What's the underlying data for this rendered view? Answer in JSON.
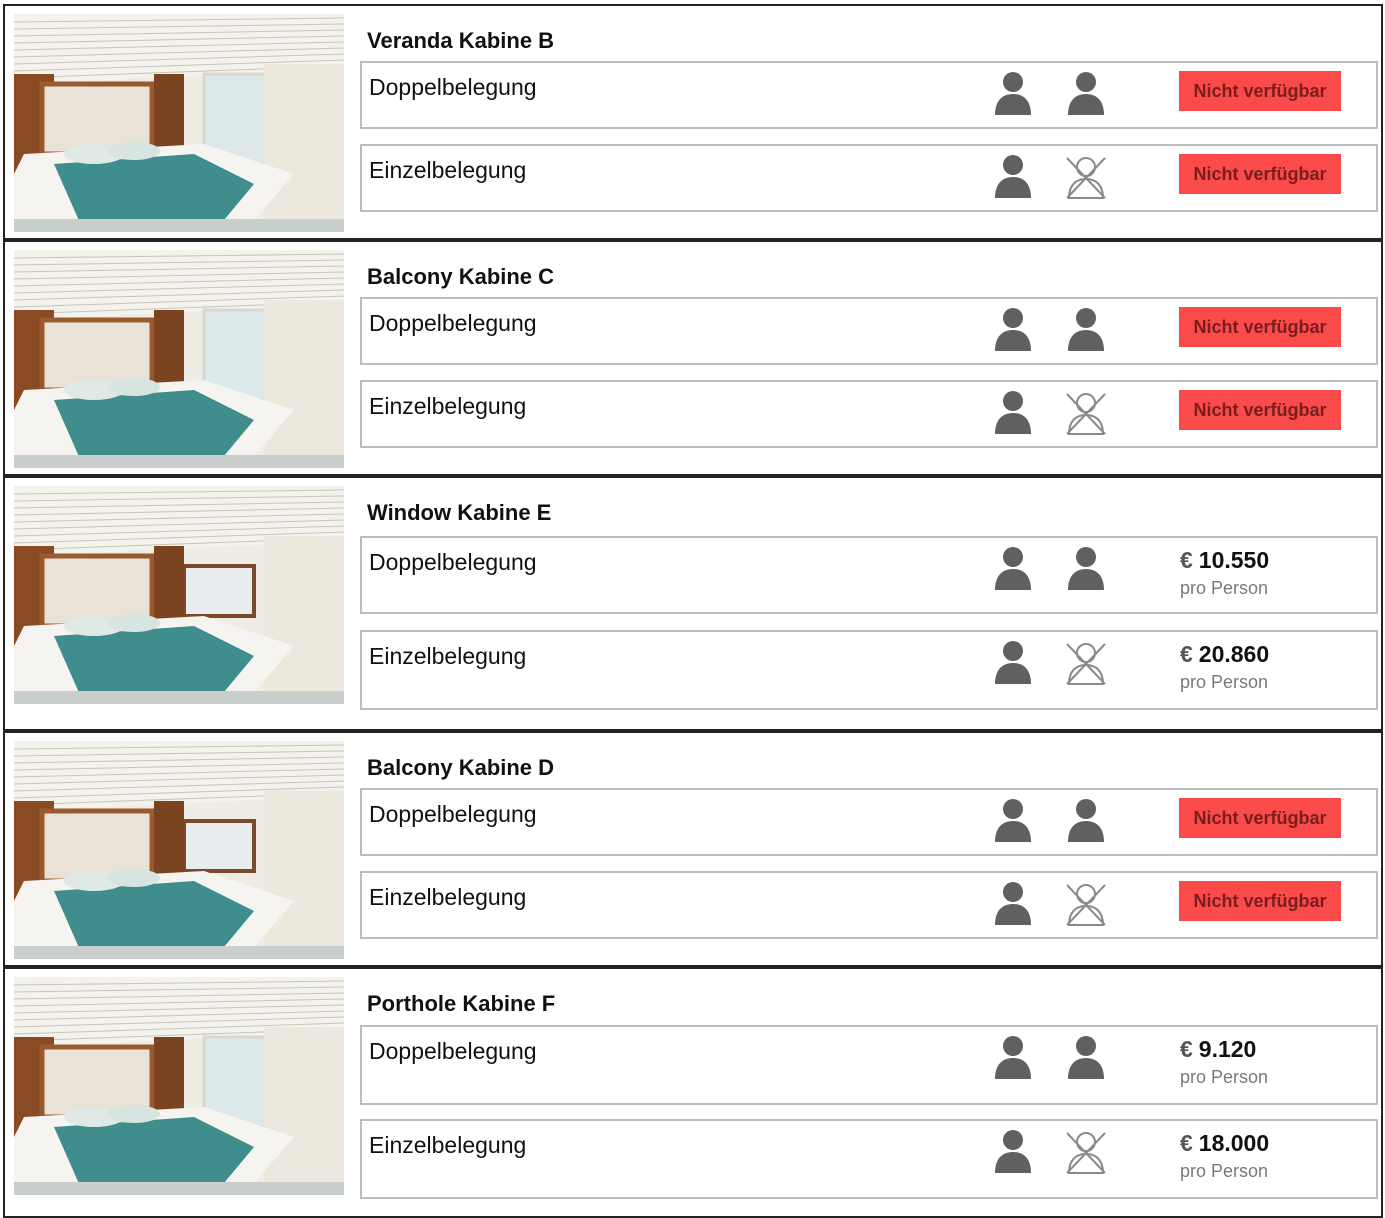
{
  "labels": {
    "double": "Doppelbelegung",
    "single": "Einzelbelegung",
    "unavailable": "Nicht verfügbar",
    "currency": "€",
    "per_person": "pro Person"
  },
  "colors": {
    "unavailable_bg": "#fb4a4a",
    "border": "#bdbdbd",
    "person_icon": "#606060"
  },
  "cabins": [
    {
      "title": "Veranda Kabine B",
      "rows": [
        {
          "label_key": "double",
          "icon_left": "person-icon",
          "icon_right": "person-icon",
          "status": "Nicht verfügbar",
          "price": null
        },
        {
          "label_key": "single",
          "icon_left": "person-icon",
          "icon_right": "person-crossed-icon",
          "status": "Nicht verfügbar",
          "price": null
        }
      ]
    },
    {
      "title": "Balcony Kabine C",
      "rows": [
        {
          "label_key": "double",
          "icon_left": "person-icon",
          "icon_right": "person-icon",
          "status": "Nicht verfügbar",
          "price": null
        },
        {
          "label_key": "single",
          "icon_left": "person-icon",
          "icon_right": "person-crossed-icon",
          "status": "Nicht verfügbar",
          "price": null
        }
      ]
    },
    {
      "title": "Window Kabine E",
      "rows": [
        {
          "label_key": "double",
          "icon_left": "person-icon",
          "icon_right": "person-icon",
          "status": null,
          "price": "10.550"
        },
        {
          "label_key": "single",
          "icon_left": "person-icon",
          "icon_right": "person-crossed-icon",
          "status": null,
          "price": "20.860"
        }
      ]
    },
    {
      "title": "Balcony Kabine D",
      "rows": [
        {
          "label_key": "double",
          "icon_left": "person-icon",
          "icon_right": "person-icon",
          "status": "Nicht verfügbar",
          "price": null
        },
        {
          "label_key": "single",
          "icon_left": "person-icon",
          "icon_right": "person-crossed-icon",
          "status": "Nicht verfügbar",
          "price": null
        }
      ]
    },
    {
      "title": "Porthole Kabine F",
      "rows": [
        {
          "label_key": "double",
          "icon_left": "person-icon",
          "icon_right": "person-icon",
          "status": null,
          "price": "9.120"
        },
        {
          "label_key": "single",
          "icon_left": "person-icon",
          "icon_right": "person-crossed-icon",
          "status": null,
          "price": "18.000"
        }
      ]
    }
  ]
}
